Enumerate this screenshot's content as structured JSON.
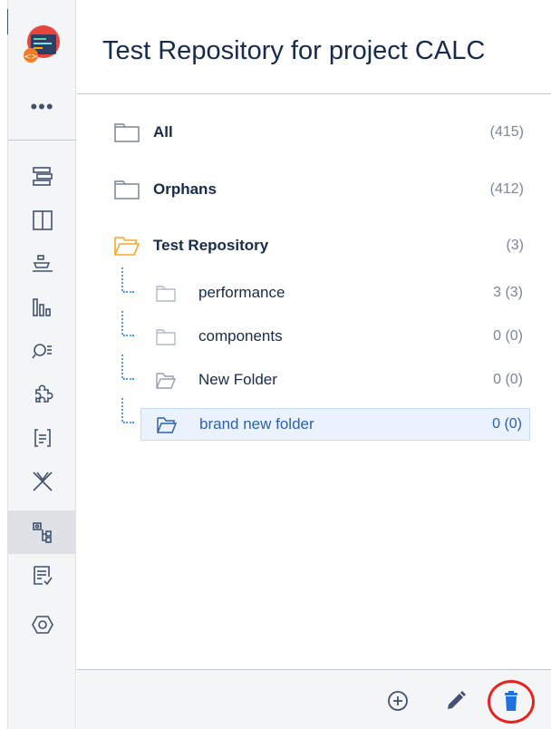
{
  "header": {
    "title": "Test Repository for project CALC"
  },
  "sidebar": {
    "more_label": "•••",
    "items": [
      {
        "name": "nav-summary",
        "icon": "summary-icon"
      },
      {
        "name": "nav-board",
        "icon": "board-icon"
      },
      {
        "name": "nav-releases",
        "icon": "ship-icon"
      },
      {
        "name": "nav-reports",
        "icon": "reports-icon"
      },
      {
        "name": "nav-issues",
        "icon": "search-list-icon"
      },
      {
        "name": "nav-components",
        "icon": "puzzle-icon"
      },
      {
        "name": "nav-code",
        "icon": "code-icon"
      },
      {
        "name": "nav-test",
        "icon": "xray-icon"
      },
      {
        "name": "nav-test-repository",
        "icon": "repository-tree-icon",
        "active": true
      },
      {
        "name": "nav-test-plans",
        "icon": "checklist-icon"
      },
      {
        "name": "nav-settings",
        "icon": "hexagon-gear-icon"
      }
    ]
  },
  "tree": {
    "roots": [
      {
        "label": "All",
        "count": "(415)"
      },
      {
        "label": "Orphans",
        "count": "(412)"
      },
      {
        "label": "Test Repository",
        "count": "(3)"
      }
    ],
    "children": [
      {
        "label": "performance",
        "count": "3 (3)"
      },
      {
        "label": "components",
        "count": "0 (0)"
      },
      {
        "label": "New Folder",
        "count": "0 (0)"
      },
      {
        "label": "brand new folder",
        "count": "0 (0)",
        "selected": true
      }
    ]
  },
  "footer": {
    "actions": [
      "add-folder-icon",
      "edit-icon",
      "delete-icon"
    ],
    "colors": {
      "delete": "#1f6fe0",
      "highlight": "#e8231f"
    }
  },
  "colors": {
    "accent": "#2f61ad",
    "folder_open": "#f5a623",
    "sidebar_bg": "#f4f5f7"
  }
}
